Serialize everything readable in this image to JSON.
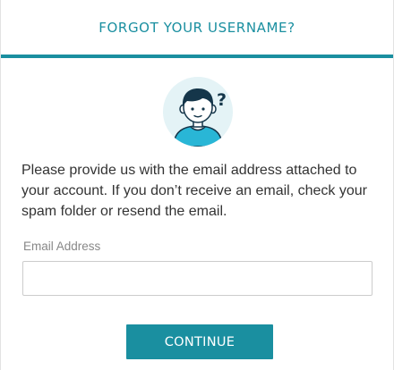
{
  "dialog": {
    "title": "FORGOT YOUR USERNAME?",
    "illustration": "user-question-icon",
    "message": "Please provide us with the email address attached to your account. If you don’t receive an email, check your spam folder or resend the email.",
    "email_label": "Email Address",
    "email_value": "",
    "email_placeholder": "",
    "continue_label": "CONTINUE"
  },
  "colors": {
    "accent": "#1a8fa0",
    "avatar_bg": "#e4f3f6",
    "avatar_shirt": "#29b6d6",
    "text": "#333333",
    "label": "#888888"
  }
}
